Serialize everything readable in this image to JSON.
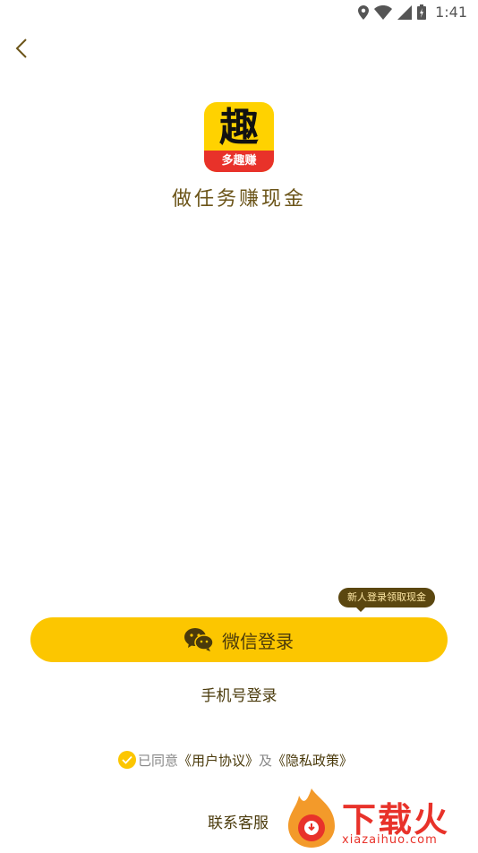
{
  "status_bar": {
    "time": "1:41"
  },
  "app": {
    "logo_glyph": "趣",
    "logo_ribbon": "多趣赚",
    "slogan": "做任务赚现金"
  },
  "login": {
    "tooltip": "新人登录领取现金",
    "wechat_label": "微信登录",
    "phone_label": "手机号登录"
  },
  "agreement": {
    "prefix": "已同意",
    "user_agreement": "《用户协议》",
    "and": "及",
    "privacy_policy": "《隐私政策》"
  },
  "footer": {
    "contact": "联系客服"
  },
  "watermark": {
    "text": "下载火",
    "sub": "xiazaihuo.com"
  },
  "colors": {
    "accent": "#fcc600",
    "text_brown": "#4a3a0b",
    "brand_red": "#e8322a"
  }
}
